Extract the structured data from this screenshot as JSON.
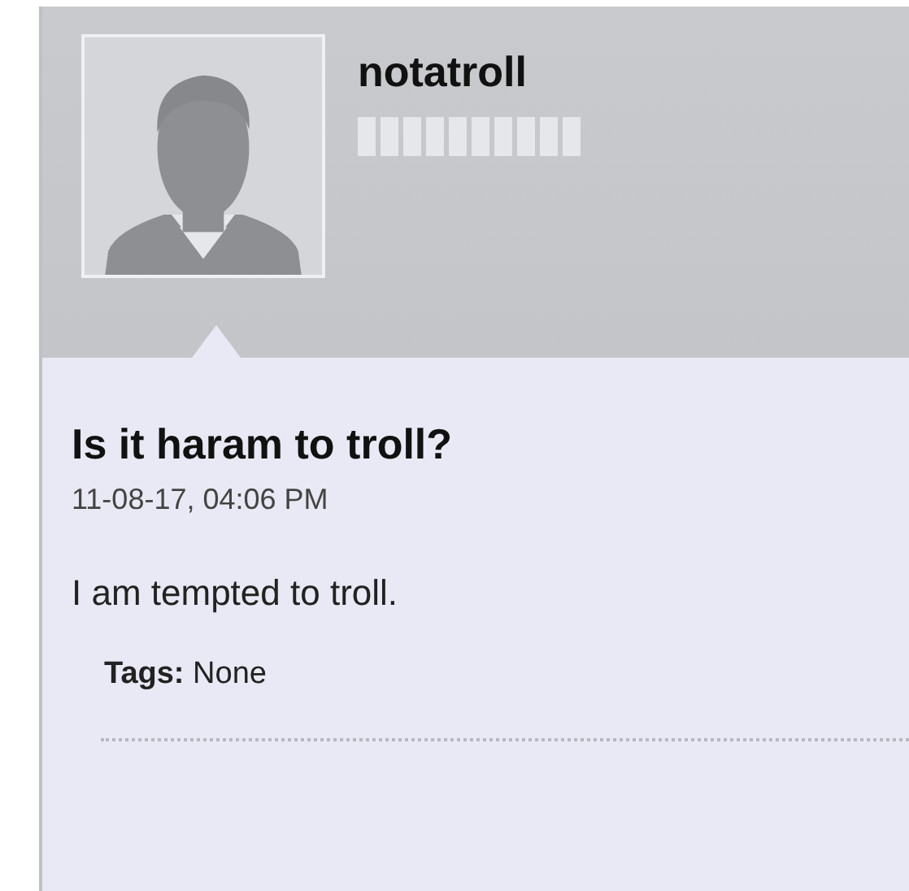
{
  "author": {
    "username": "notatroll"
  },
  "post": {
    "title": "Is it haram to troll?",
    "date": "11-08-17, 04:06 PM",
    "body": "I am tempted to troll.",
    "tags_label": "Tags:",
    "tags_value": "None"
  }
}
